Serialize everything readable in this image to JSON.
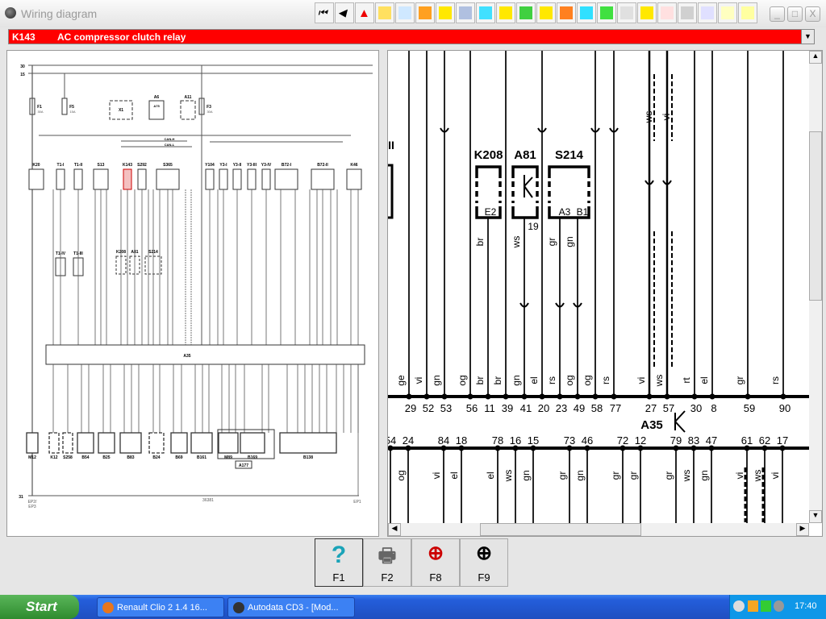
{
  "window": {
    "title": "Wiring diagram",
    "minimize": "_",
    "maximize": "□",
    "close": "X"
  },
  "toolbar": {
    "icons": [
      "first-page-icon",
      "previous-page-icon",
      "warning-icon",
      "component-icon",
      "tools-icon",
      "engine-icon",
      "timing-icon",
      "wheel-icon",
      "diagnostic-icon",
      "battery-icon",
      "seat-icon",
      "injector-icon",
      "spark-plug-icon",
      "relay-icon",
      "printer-icon",
      "document-icon",
      "warning-lights-icon",
      "service-icon",
      "gear-icon",
      "triangle-icon",
      "key-icon",
      "note-icon"
    ],
    "colors": [
      "#fff",
      "#fff",
      "#ffe800",
      "#ffe060",
      "#cfe8ff",
      "#ffa020",
      "#ffe800",
      "#b0c0e0",
      "#40e0ff",
      "#ffe800",
      "#40d040",
      "#ffe800",
      "#ff8020",
      "#30e0ff",
      "#40e040",
      "#e0e0e0",
      "#ffe800",
      "#ffe0e0",
      "#d0d0d0",
      "#e0e0ff",
      "#ffffc0",
      "#ffffa0"
    ]
  },
  "selector": {
    "code": "K143",
    "description": "AC compressor clutch relay"
  },
  "overview": {
    "rails": [
      "30",
      "15",
      "31"
    ],
    "fuses": [
      {
        "name": "F1",
        "rating": "30A"
      },
      {
        "name": "F5",
        "rating": "15A"
      },
      {
        "name": "F3",
        "rating": "30A"
      }
    ],
    "bus": [
      "CAN-H",
      "CAN-L"
    ],
    "top_components": [
      "X1",
      "A6",
      "A75",
      "A11",
      "K20",
      "T1-I",
      "T1-II",
      "S13",
      "K143",
      "S292",
      "S365",
      "Y104",
      "Y3-I",
      "Y3-II",
      "Y3-III",
      "Y3-IV",
      "B72-I",
      "B72-II",
      "K46",
      "T1-IV",
      "T1-III",
      "K208",
      "A81",
      "S214"
    ],
    "ecu": "A35",
    "bottom_components": [
      "M12",
      "K12",
      "S258",
      "B54",
      "B25",
      "B83",
      "B24",
      "B69",
      "B161",
      "M89",
      "B169",
      "B138"
    ],
    "module": "A177",
    "grounds": [
      "EP2/",
      "EP3",
      "EP1"
    ],
    "ref": "36381"
  },
  "detail": {
    "left_fragment": "II",
    "components": [
      {
        "name": "K208",
        "pins": [
          "E2"
        ]
      },
      {
        "name": "A81",
        "pins": [
          "19"
        ]
      },
      {
        "name": "S214",
        "pins": [
          "A3",
          "B1"
        ]
      }
    ],
    "component_wire_colors": [
      "br",
      "ws",
      "gr",
      "gn"
    ],
    "upper_wire_colors": [
      "ws",
      "vi"
    ],
    "ecu": "A35",
    "top_pins": [
      "29",
      "52",
      "53",
      "56",
      "11",
      "39",
      "41",
      "20",
      "23",
      "49",
      "58",
      "77",
      "27",
      "57",
      "30",
      "8",
      "59",
      "90"
    ],
    "top_wire_colors": [
      "ge",
      "vi",
      "gn",
      "og",
      "br",
      "br",
      "gn",
      "el",
      "rs",
      "og",
      "og",
      "rs",
      "vi",
      "ws",
      "rt",
      "el",
      "gr",
      "rs"
    ],
    "bottom_pins": [
      "54",
      "24",
      "84",
      "18",
      "78",
      "16",
      "15",
      "73",
      "46",
      "72",
      "12",
      "79",
      "83",
      "47",
      "61",
      "62",
      "17"
    ],
    "bottom_wire_colors": [
      "",
      "og",
      "vi",
      "el",
      "el",
      "ws",
      "gn",
      "gr",
      "gn",
      "gr",
      "gr",
      "gr",
      "ws",
      "gn",
      "vi",
      "ws",
      "vi"
    ]
  },
  "fkeys": [
    {
      "key": "F1",
      "icon": "help-icon"
    },
    {
      "key": "F2",
      "icon": "print-icon"
    },
    {
      "key": "F8",
      "icon": "zoom-component-icon"
    },
    {
      "key": "F9",
      "icon": "zoom-icon"
    }
  ],
  "taskbar": {
    "start": "Start",
    "tasks": [
      "Renault Clio 2 1.4 16...",
      "Autodata CD3 - [Mod..."
    ],
    "clock": "17:40"
  }
}
